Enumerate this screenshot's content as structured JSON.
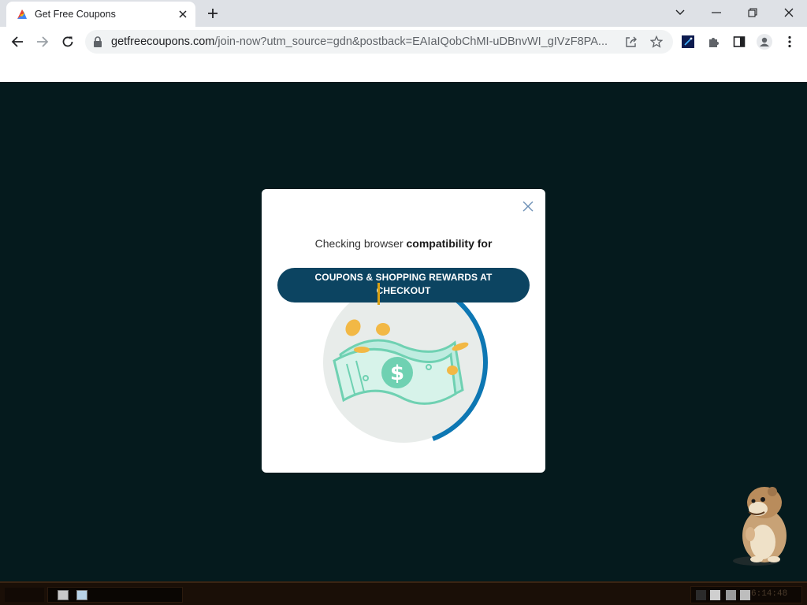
{
  "browser": {
    "tab_title": "Get Free Coupons",
    "url_host": "getfreecoupons.com",
    "url_path": "/join-now?utm_source=gdn&postback=EAIaIQobChMI-uDBnvWI_gIVzF8PA..."
  },
  "modal": {
    "checking_prefix": "Checking browser ",
    "checking_bold": "compatibility for",
    "pill_text": "COUPONS & SHOPPING REWARDS AT CHECKOUT",
    "progress_fraction": 0.4
  },
  "taskbar": {
    "clock": "6:14:48"
  },
  "colors": {
    "page_bg": "#051a1d",
    "pill_bg": "#0c4461",
    "progress_ring": "#0d77b3",
    "bill_green": "#6fd1b2"
  },
  "icons": [
    "favicon-icon",
    "close-icon",
    "plus-icon",
    "minimize-icon",
    "restore-icon",
    "back-icon",
    "forward-icon",
    "reload-icon",
    "lock-icon",
    "share-icon",
    "star-icon",
    "extension-icon",
    "puzzle-icon",
    "sidepanel-icon",
    "profile-icon",
    "more-icon",
    "money-icon",
    "hamster-icon"
  ]
}
